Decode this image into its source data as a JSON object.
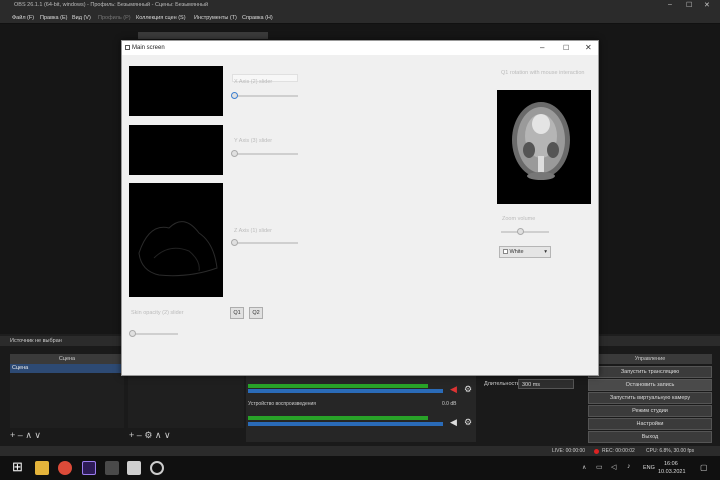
{
  "obs": {
    "title": "OBS 26.1.1 (64-bit, windows) - Профиль: Безымянный - Сцены: Безымянный",
    "menu": [
      "Файл (F)",
      "Правка (E)",
      "Вид (V)",
      "Профиль (P)",
      "Коллекция сцен (S)",
      "Инструменты (T)",
      "Справка (H)"
    ],
    "status_source": "Источник не выбран",
    "scenes_header": "Сцена",
    "scene_item": "Сцена",
    "mixer_device": "Устройство воспроизведения",
    "mixer_db": "0.0 dB",
    "transitions_duration_label": "Длительность",
    "transitions_duration_value": "300 ms",
    "controls_header": "Управление",
    "controls": [
      "Запустить трансляцию",
      "Остановить запись",
      "Запустить виртуальную камеру",
      "Режим студии",
      "Настройки",
      "Выход"
    ],
    "status_live": "LIVE: 00:00:00",
    "status_rec": "REC: 00:00:02",
    "status_cpu": "CPU: 6.8%, 30.00 fps"
  },
  "win": {
    "title": "Main screen",
    "x_label": "X Axis (2) slider",
    "y_label": "Y Axis (3) slider",
    "z_label": "Z Axis (1) slider",
    "q_label": "Q1 rotation with mouse interaction",
    "opacity_label": "Skin opacity (2) slider",
    "zoom_label": "Zoom volume",
    "btn_q1": "Q1",
    "btn_q2": "Q2",
    "color_select": "White"
  },
  "taskbar": {
    "lang": "ENG",
    "time": "16:06",
    "date": "10.03.2021"
  }
}
